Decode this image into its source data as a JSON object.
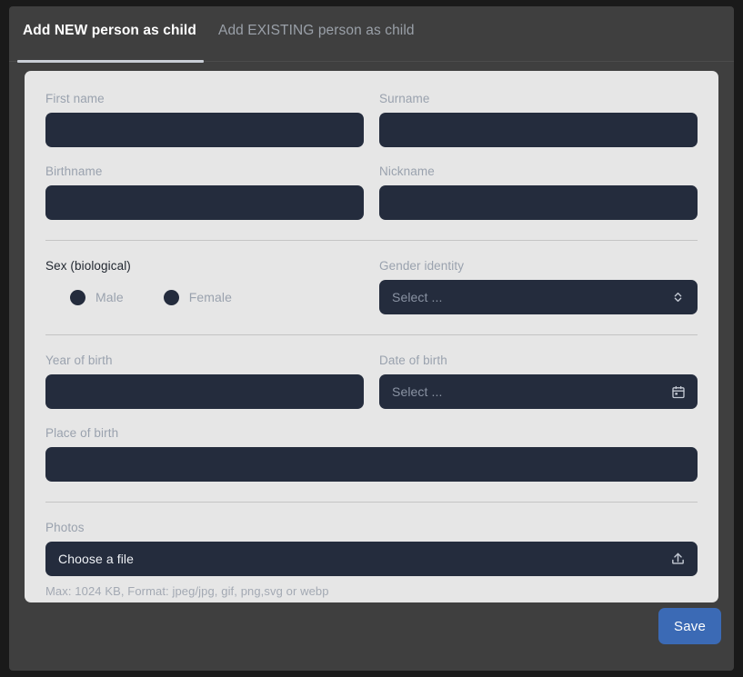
{
  "theme": {
    "page_bg": "#1a1a1a",
    "panel_bg": "#3f3f3f",
    "card_bg": "#e6e6e6",
    "input_bg": "#242c3d",
    "accent": "#3b6ab5",
    "label_muted": "#9aa2ae",
    "divider": "#c4c4c4"
  },
  "tabs": [
    {
      "id": "add-new",
      "label": "Add NEW person as child",
      "active": true
    },
    {
      "id": "add-existing",
      "label": "Add EXISTING person as child",
      "active": false
    }
  ],
  "form": {
    "first_name": {
      "label": "First name",
      "value": "",
      "placeholder": ""
    },
    "surname": {
      "label": "Surname",
      "value": "",
      "placeholder": ""
    },
    "birthname": {
      "label": "Birthname",
      "value": "",
      "placeholder": ""
    },
    "nickname": {
      "label": "Nickname",
      "value": "",
      "placeholder": ""
    },
    "sex": {
      "label": "Sex (biological)",
      "options": [
        {
          "id": "male",
          "label": "Male",
          "selected": false
        },
        {
          "id": "female",
          "label": "Female",
          "selected": false
        }
      ]
    },
    "gender_identity": {
      "label": "Gender identity",
      "value": "Select ...",
      "icon": "chevron-up-down-icon"
    },
    "year_of_birth": {
      "label": "Year of birth",
      "value": "",
      "placeholder": ""
    },
    "date_of_birth": {
      "label": "Date of birth",
      "value": "Select ...",
      "icon": "calendar-icon"
    },
    "place_of_birth": {
      "label": "Place of birth",
      "value": "",
      "placeholder": ""
    },
    "photos": {
      "label": "Photos",
      "value": "Choose a file",
      "icon": "upload-icon",
      "helper": "Max: 1024 KB, Format: jpeg/jpg, gif, png,svg or webp"
    }
  },
  "footer": {
    "save_label": "Save"
  }
}
